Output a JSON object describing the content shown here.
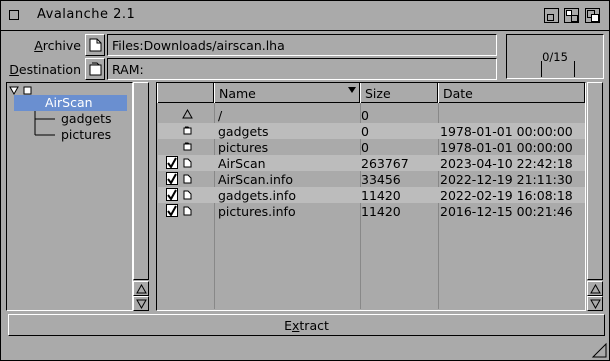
{
  "window": {
    "title": "Avalanche 2.1"
  },
  "header": {
    "archive_label_key": "A",
    "archive_label_rest": "rchive",
    "archive_value": "Files:Downloads/airscan.lha",
    "destination_label_key": "D",
    "destination_label_rest": "estination",
    "destination_value": "RAM:",
    "progress_text": "0/15",
    "progress_fraction": 0
  },
  "tree": {
    "root": "AirScan",
    "children": [
      "gadgets",
      "pictures"
    ]
  },
  "list": {
    "columns": [
      "Name",
      "Size",
      "Date"
    ],
    "sort_column": "Name",
    "rows": [
      {
        "name": "/",
        "size": "0",
        "date": "",
        "checked": false,
        "icon": "parent-arrow-icon"
      },
      {
        "name": "gadgets",
        "size": "0",
        "date": "1978-01-01 00:00:00",
        "checked": false,
        "icon": "drawer-icon"
      },
      {
        "name": "pictures",
        "size": "0",
        "date": "1978-01-01 00:00:00",
        "checked": false,
        "icon": "drawer-icon"
      },
      {
        "name": "AirScan",
        "size": "263767",
        "date": "2023-04-10 22:42:18",
        "checked": true,
        "icon": "file-icon"
      },
      {
        "name": "AirScan.info",
        "size": "33456",
        "date": "2022-12-19 21:11:30",
        "checked": true,
        "icon": "file-icon"
      },
      {
        "name": "gadgets.info",
        "size": "11420",
        "date": "2022-02-19 16:08:18",
        "checked": true,
        "icon": "file-icon"
      },
      {
        "name": "pictures.info",
        "size": "11420",
        "date": "2016-12-15 00:21:46",
        "checked": true,
        "icon": "file-icon"
      }
    ]
  },
  "footer": {
    "extract_pre": "E",
    "extract_key": "x",
    "extract_post": "tract"
  }
}
